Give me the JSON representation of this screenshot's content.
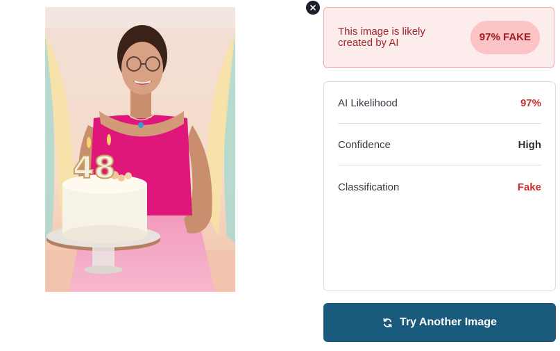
{
  "verdict": {
    "message": "This image is likely created by AI",
    "badge": "97% FAKE"
  },
  "metrics": [
    {
      "label": "AI Likelihood",
      "value": "97%",
      "color": "#c9302c"
    },
    {
      "label": "Confidence",
      "value": "High",
      "color": "#2b3138"
    },
    {
      "label": "Classification",
      "value": "Fake",
      "color": "#c9302c"
    }
  ],
  "actions": {
    "try_another_label": "Try Another Image"
  },
  "icons": {
    "close": "close-icon",
    "refresh": "refresh-icon"
  },
  "colors": {
    "fake_red": "#c9302c",
    "badge_bg": "#fbc3c6",
    "alert_bg": "#fdecec",
    "primary_button": "#1a5a7c"
  },
  "image": {
    "cake_candles": "48"
  }
}
